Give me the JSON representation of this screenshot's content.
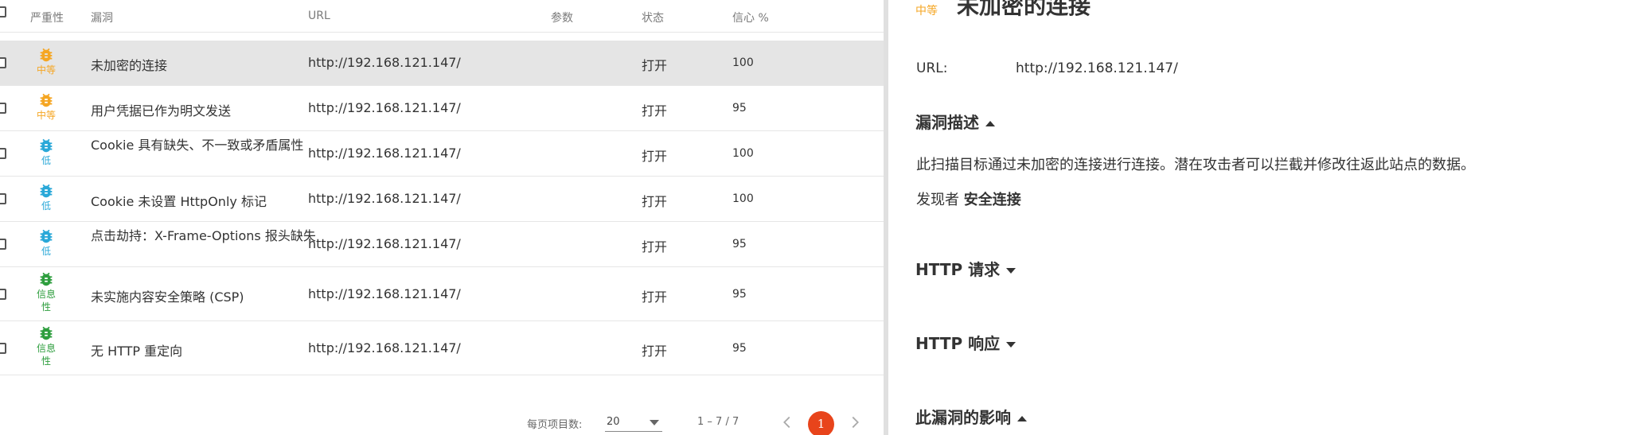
{
  "table": {
    "headers": {
      "severity": "严重性",
      "vulnerability": "漏洞",
      "url": "URL",
      "params": "参数",
      "status": "状态",
      "confidence": "信心 %"
    },
    "rows": [
      {
        "severity": "中等",
        "severity_color": "#f5a623",
        "name": "未加密的连接",
        "url": "http://192.168.121.147/",
        "status": "打开",
        "confidence": "100"
      },
      {
        "severity": "中等",
        "severity_color": "#f5a623",
        "name": "用户凭据已作为明文发送",
        "url": "http://192.168.121.147/",
        "status": "打开",
        "confidence": "95"
      },
      {
        "severity": "低",
        "severity_color": "#2aa8d8",
        "name": "Cookie 具有缺失、不一致或矛盾属性",
        "url": "http://192.168.121.147/",
        "status": "打开",
        "confidence": "100"
      },
      {
        "severity": "低",
        "severity_color": "#2aa8d8",
        "name": "Cookie 未设置 HttpOnly 标记",
        "url": "http://192.168.121.147/",
        "status": "打开",
        "confidence": "100"
      },
      {
        "severity": "低",
        "severity_color": "#2aa8d8",
        "name": "点击劫持：X-Frame-Options 报头缺失",
        "url": "http://192.168.121.147/",
        "status": "打开",
        "confidence": "95"
      },
      {
        "severity": "信息性",
        "severity_color": "#2e9e3e",
        "name": "未实施内容安全策略 (CSP)",
        "url": "http://192.168.121.147/",
        "status": "打开",
        "confidence": "95"
      },
      {
        "severity": "信息性",
        "severity_color": "#2e9e3e",
        "name": "无 HTTP 重定向",
        "url": "http://192.168.121.147/",
        "status": "打开",
        "confidence": "95"
      }
    ]
  },
  "pagination": {
    "items_per_page_label": "每页项目数:",
    "items_per_page": "20",
    "range": "1 – 7 / 7",
    "current_page": "1"
  },
  "detail": {
    "severity": "中等",
    "title": "未加密的连接",
    "url_label": "URL:",
    "url": "http://192.168.121.147/",
    "sections": {
      "description": "漏洞描述",
      "http_request": "HTTP 请求",
      "http_response": "HTTP 响应",
      "impact": "此漏洞的影响"
    },
    "description_text": "此扫描目标通过未加密的连接进行连接。潜在攻击者可以拦截并修改往返此站点的数据。",
    "found_by_label": "发现者",
    "found_by": "安全连接"
  },
  "colors": {
    "medium": "#f5a623",
    "low": "#2aa8d8",
    "info": "#2e9e3e",
    "page_active": "#e8441b",
    "selected_row": "#e5e5e5"
  }
}
